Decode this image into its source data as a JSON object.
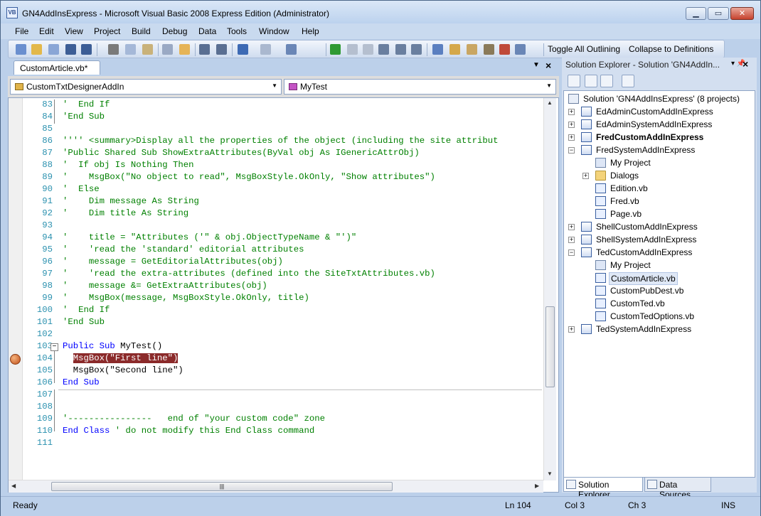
{
  "window": {
    "title": "GN4AddInsExpress - Microsoft Visual Basic 2008 Express Edition (Administrator)",
    "app_icon": "VB"
  },
  "menu": [
    "File",
    "Edit",
    "View",
    "Project",
    "Build",
    "Debug",
    "Data",
    "Tools",
    "Window",
    "Help"
  ],
  "toolbar": {
    "toggle_outlining": "Toggle All Outlining",
    "collapse_definitions": "Collapse to Definitions"
  },
  "editor": {
    "tab": "CustomArticle.vb*",
    "class_combo": "CustomTxtDesignerAddIn",
    "member_combo": "MyTest",
    "lines": [
      {
        "n": "83",
        "text": "'  End If",
        "cls": "cm"
      },
      {
        "n": "84",
        "text": "'End Sub",
        "cls": "cm"
      },
      {
        "n": "85",
        "text": "",
        "cls": "pl"
      },
      {
        "n": "86",
        "text": "'''' <summary>Display all the properties of the object (including the site attribut",
        "cls": "cm"
      },
      {
        "n": "87",
        "text": "'Public Shared Sub ShowExtraAttributes(ByVal obj As IGenericAttrObj)",
        "cls": "cm"
      },
      {
        "n": "88",
        "text": "'  If obj Is Nothing Then",
        "cls": "cm"
      },
      {
        "n": "89",
        "text": "'    MsgBox(\"No object to read\", MsgBoxStyle.OkOnly, \"Show attributes\")",
        "cls": "cm"
      },
      {
        "n": "90",
        "text": "'  Else",
        "cls": "cm"
      },
      {
        "n": "91",
        "text": "'    Dim message As String",
        "cls": "cm"
      },
      {
        "n": "92",
        "text": "'    Dim title As String",
        "cls": "cm"
      },
      {
        "n": "93",
        "text": "",
        "cls": "pl"
      },
      {
        "n": "94",
        "text": "'    title = \"Attributes ('\" & obj.ObjectTypeName & \"')\"",
        "cls": "cm"
      },
      {
        "n": "95",
        "text": "'    'read the 'standard' editorial attributes",
        "cls": "cm"
      },
      {
        "n": "96",
        "text": "'    message = GetEditorialAttributes(obj)",
        "cls": "cm"
      },
      {
        "n": "97",
        "text": "'    'read the extra-attributes (defined into the SiteTxtAttributes.vb)",
        "cls": "cm"
      },
      {
        "n": "98",
        "text": "'    message &= GetExtraAttributes(obj)",
        "cls": "cm"
      },
      {
        "n": "99",
        "text": "'    MsgBox(message, MsgBoxStyle.OkOnly, title)",
        "cls": "cm"
      },
      {
        "n": "100",
        "text": "'  End If",
        "cls": "cm"
      },
      {
        "n": "101",
        "text": "'End Sub",
        "cls": "cm"
      },
      {
        "n": "102",
        "text": "",
        "cls": "pl"
      },
      {
        "n": "103",
        "kw": "Public Sub",
        "text": " MyTest()",
        "cls": "pl"
      },
      {
        "n": "104",
        "text": "MsgBox(\"First line\")",
        "cls": "bp"
      },
      {
        "n": "105",
        "text": "  MsgBox(\"Second line\")",
        "cls": "pl"
      },
      {
        "n": "106",
        "kw": "End Sub",
        "text": "",
        "cls": "pl"
      },
      {
        "n": "107",
        "text": "",
        "cls": "pl"
      },
      {
        "n": "108",
        "text": "",
        "cls": "pl"
      },
      {
        "n": "109",
        "text": "'----------------   end of \"your custom code\" zone",
        "cls": "cm"
      },
      {
        "n": "110",
        "kw": "End Class",
        "text": " ' do not modify this End Class command",
        "cls": "mix"
      },
      {
        "n": "111",
        "text": "",
        "cls": "pl"
      }
    ]
  },
  "solution_explorer": {
    "title": "Solution Explorer - Solution 'GN4AddIn...",
    "items": [
      {
        "label": "Solution 'GN4AddInsExpress' (8 projects)",
        "icon": "solution-icon",
        "level": 0,
        "expander": "",
        "bold": false
      },
      {
        "label": "EdAdminCustomAddInExpress",
        "icon": "vb-project-icon",
        "level": 1,
        "expander": "+",
        "bold": false
      },
      {
        "label": "EdAdminSystemAddInExpress",
        "icon": "vb-project-icon",
        "level": 1,
        "expander": "+",
        "bold": false
      },
      {
        "label": "FredCustomAddInExpress",
        "icon": "vb-project-icon",
        "level": 1,
        "expander": "+",
        "bold": true
      },
      {
        "label": "FredSystemAddInExpress",
        "icon": "vb-project-icon",
        "level": 1,
        "expander": "-",
        "bold": false
      },
      {
        "label": "My Project",
        "icon": "my-project-icon",
        "level": 2,
        "expander": "",
        "bold": false
      },
      {
        "label": "Dialogs",
        "icon": "folder-icon",
        "level": 2,
        "expander": "+",
        "bold": false
      },
      {
        "label": "Edition.vb",
        "icon": "vb-file-icon",
        "level": 2,
        "expander": "",
        "bold": false
      },
      {
        "label": "Fred.vb",
        "icon": "vb-file-icon",
        "level": 2,
        "expander": "",
        "bold": false
      },
      {
        "label": "Page.vb",
        "icon": "vb-file-icon",
        "level": 2,
        "expander": "",
        "bold": false
      },
      {
        "label": "ShellCustomAddInExpress",
        "icon": "vb-project-icon",
        "level": 1,
        "expander": "+",
        "bold": false
      },
      {
        "label": "ShellSystemAddInExpress",
        "icon": "vb-project-icon",
        "level": 1,
        "expander": "+",
        "bold": false
      },
      {
        "label": "TedCustomAddInExpress",
        "icon": "vb-project-icon",
        "level": 1,
        "expander": "-",
        "bold": false
      },
      {
        "label": "My Project",
        "icon": "my-project-icon",
        "level": 2,
        "expander": "",
        "bold": false
      },
      {
        "label": "CustomArticle.vb",
        "icon": "vb-file-icon",
        "level": 2,
        "expander": "",
        "bold": false,
        "selected": true
      },
      {
        "label": "CustomPubDest.vb",
        "icon": "vb-file-icon",
        "level": 2,
        "expander": "",
        "bold": false
      },
      {
        "label": "CustomTed.vb",
        "icon": "vb-file-icon",
        "level": 2,
        "expander": "",
        "bold": false
      },
      {
        "label": "CustomTedOptions.vb",
        "icon": "vb-file-icon",
        "level": 2,
        "expander": "",
        "bold": false
      },
      {
        "label": "TedSystemAddInExpress",
        "icon": "vb-project-icon",
        "level": 1,
        "expander": "+",
        "bold": false
      }
    ],
    "tabs": [
      "Solution Explorer",
      "Data Sources"
    ]
  },
  "status": {
    "ready": "Ready",
    "line": "Ln 104",
    "col": "Col 3",
    "ch": "Ch 3",
    "mode": "INS"
  }
}
